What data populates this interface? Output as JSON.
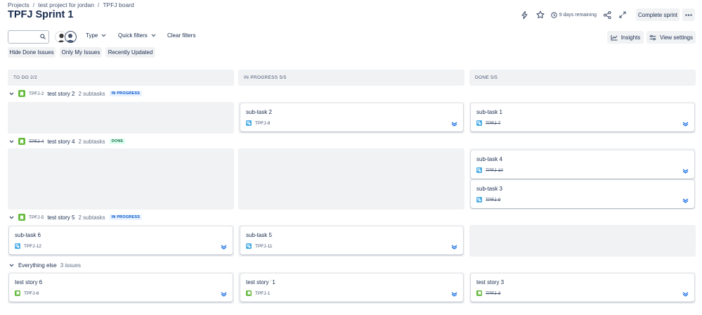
{
  "breadcrumb": {
    "projects": "Projects",
    "project": "test project for jordan",
    "board": "TPFJ board",
    "separator": "/"
  },
  "title": "TPFJ Sprint 1",
  "header": {
    "days_remaining": "9 days remaining",
    "complete_sprint": "Complete sprint"
  },
  "filters": {
    "type": "Type",
    "quick_filters": "Quick filters",
    "clear_filters": "Clear filters",
    "insights": "Insights",
    "view_settings": "View settings"
  },
  "quick_filters": [
    "Hide Done Issues",
    "Only My Issues",
    "Recently Updated"
  ],
  "columns": [
    {
      "name": "TO DO",
      "count": "2/2"
    },
    {
      "name": "IN PROGRESS",
      "count": "5/5"
    },
    {
      "name": "DONE",
      "count": "5/5"
    }
  ],
  "swimlanes": [
    {
      "key": "TPFJ-2",
      "summary": "test story 2",
      "subtasks": "2 subtasks",
      "status": "IN PROGRESS"
    },
    {
      "key": "TPFJ-4",
      "summary": "test story 4",
      "subtasks": "2 subtasks",
      "status": "DONE"
    },
    {
      "key": "TPFJ-5",
      "summary": "test story 5",
      "subtasks": "2 subtasks",
      "status": "IN PROGRESS"
    },
    {
      "label": "Everything else",
      "count": "3 issues"
    }
  ],
  "cards": [
    {
      "title": "sub-task 2",
      "key": "TPFJ-8"
    },
    {
      "title": "sub-task 1",
      "key": "TPFJ-7"
    },
    {
      "title": "sub-task 4",
      "key": "TPFJ-10"
    },
    {
      "title": "sub-task 3",
      "key": "TPFJ-9"
    },
    {
      "title": "sub-task 6",
      "key": "TPFJ-12"
    },
    {
      "title": "sub-task 5",
      "key": "TPFJ-11"
    },
    {
      "title": "test story 6",
      "key": "TPFJ-6"
    },
    {
      "title": "test story ˙1",
      "key": "TPFJ-1"
    },
    {
      "title": "test story 3",
      "key": "TPFJ-3"
    }
  ],
  "colors": {
    "story": "#63ba3c",
    "subtask": "#4bade8",
    "priority": "#0c66e4",
    "column_bg": "#f1f2f4"
  }
}
